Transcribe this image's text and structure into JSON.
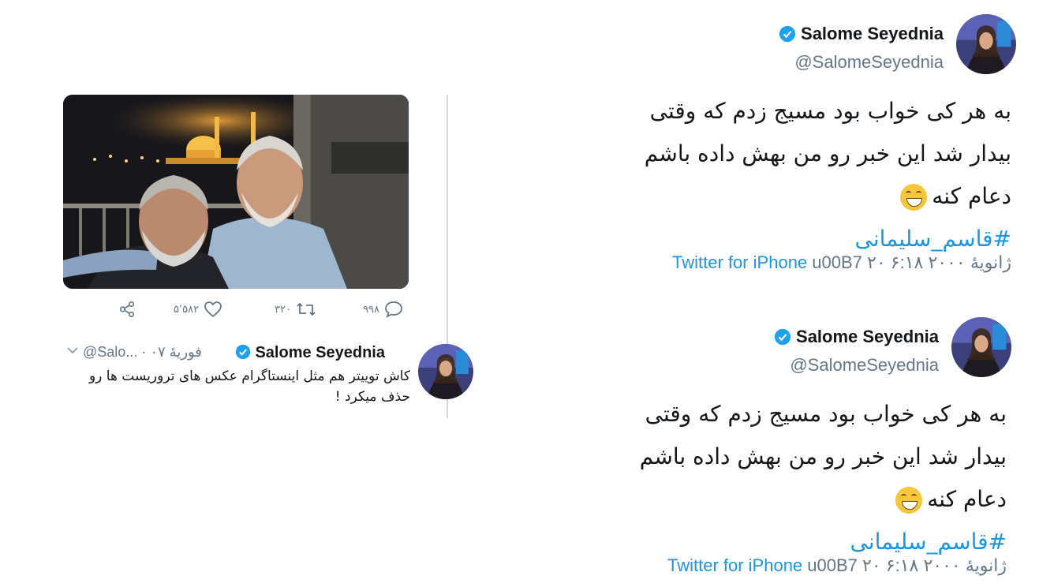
{
  "left_tweet": {
    "stats": {
      "reply_count": "۹۹۸",
      "retweet_count": "۳۲۰",
      "like_count": "۵٬۵۸۲"
    },
    "author_name": "Salome Seyednia",
    "meta": "@Salo... · ۰۷ فوريهٔ",
    "text": "کاش توییتر هم مثل اینستاگرام عکس های تروریست ها رو حذف میکرد !"
  },
  "right_tweets": [
    {
      "author_name": "Salome Seyednia",
      "handle": "@SalomeSeyednia",
      "line1": "به هر کی خواب بود مسیج زدم که وقتی",
      "line2": "بیدار شد این خبر رو من بهش داده باشم",
      "line3": "دعام کنه",
      "hashtag": "#قاسم_سلیمانی",
      "source": "Twitter for iPhone",
      "timestamp": "u00B7 ۲۰ ژانویهٔ ۲۰۰۰ ۶:۱۸"
    },
    {
      "author_name": "Salome Seyednia",
      "handle": "@SalomeSeyednia",
      "line1": "به هر کی خواب بود مسیج زدم که وقتی",
      "line2": "بیدار شد این خبر رو من بهش داده باشم",
      "line3": "دعام کنه",
      "hashtag": "#قاسم_سلیمانی",
      "source": "Twitter for iPhone",
      "timestamp": "u00B7 ۲۰ ژانویهٔ ۲۰۰۰ ۶:۱۸"
    }
  ],
  "colors": {
    "link_blue": "#1b95e0",
    "text_gray": "#657786",
    "text_dark": "#14171a",
    "verified_blue": "#1da1f2"
  },
  "icons": [
    "reply-icon",
    "retweet-icon",
    "like-icon",
    "share-icon",
    "verified-badge-icon",
    "chevron-down-icon",
    "grin-emoji-icon"
  ]
}
